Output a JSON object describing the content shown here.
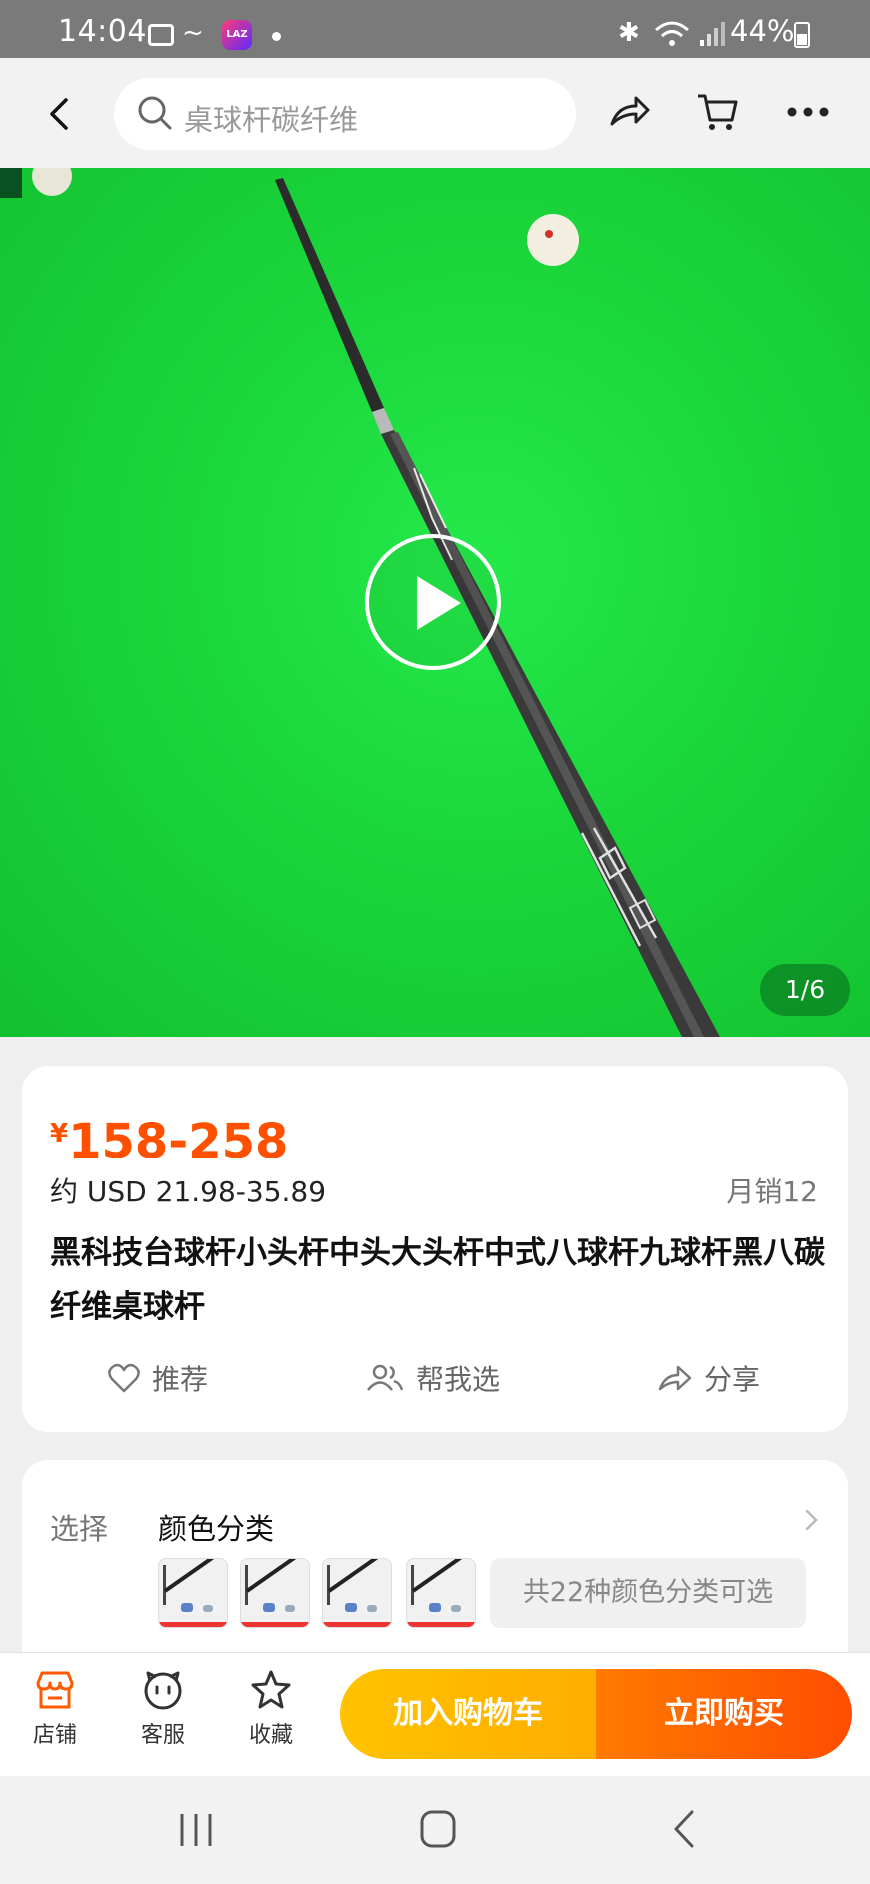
{
  "status_bar": {
    "time": "14:04",
    "battery": "44%",
    "notif_app": "LAZ"
  },
  "top_nav": {
    "search_placeholder": "桌球杆碳纤维"
  },
  "media": {
    "counter": "1/6"
  },
  "product": {
    "price_symbol": "¥",
    "price_range": "158-258",
    "usd": "约 USD 21.98-35.89",
    "monthly_sales": "月销12",
    "title": "黑科技台球杆小头杆中头大头杆中式八球杆九球杆黑八碳纤维桌球杆"
  },
  "actions": {
    "recommend": "推荐",
    "help_choose": "帮我选",
    "share": "分享"
  },
  "options": {
    "label": "选择",
    "value": "颜色分类",
    "more": "共22种颜色分类可选"
  },
  "bottom_bar": {
    "shop": "店铺",
    "service": "客服",
    "favorite": "收藏",
    "add_to_cart": "加入购物车",
    "buy_now": "立即购买"
  },
  "colors": {
    "accent": "#ff5000",
    "cart_button": "#ffb800",
    "buy_button": "#ff5a00",
    "felt_green": "#1bd83c"
  }
}
